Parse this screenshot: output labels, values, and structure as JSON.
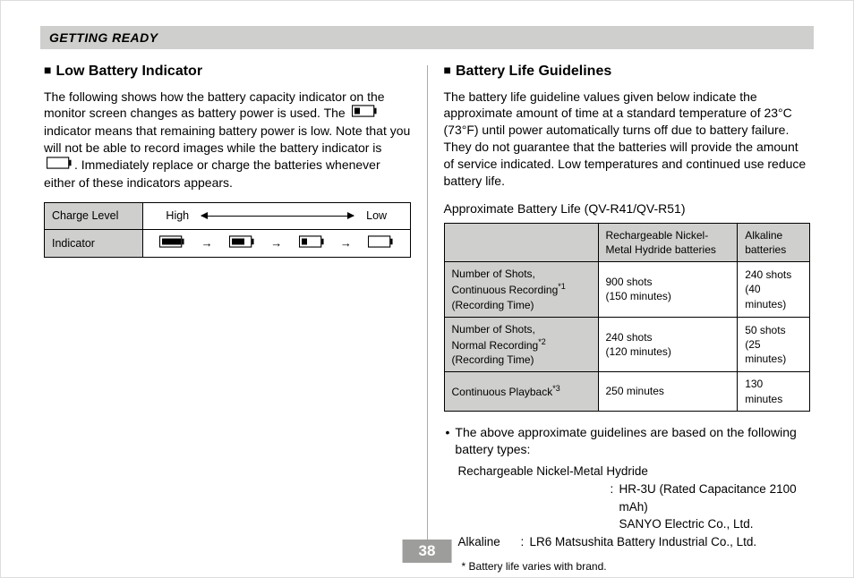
{
  "header": {
    "section": "GETTING READY"
  },
  "left": {
    "heading": "Low Battery Indicator",
    "para_a": "The following shows how the battery capacity indicator on the monitor screen changes as battery power is used. The",
    "para_b": "indicator means that remaining battery power is low. Note that you will not be able to record images while the battery indicator is",
    "para_c": ". Immediately replace or charge the batteries whenever either of these indicators appears.",
    "table": {
      "row1label": "Charge Level",
      "high": "High",
      "low": "Low",
      "row2label": "Indicator"
    }
  },
  "right": {
    "heading": "Battery Life Guidelines",
    "para": "The battery life guideline values given below indicate the approximate amount of time at a standard temperature of 23°C (73°F) until power automatically turns off due to battery failure. They do not guarantee that the batteries will provide the amount of service indicated. Low temperatures and continued use reduce battery life.",
    "caption": "Approximate Battery Life (QV-R41/QV-R51)",
    "table": {
      "head_nmh": "Rechargeable Nickel-Metal Hydride batteries",
      "head_alk": "Alkaline batteries",
      "rows": [
        {
          "label_a": "Number of Shots,",
          "label_b": "Continuous Recording",
          "sup": "*1",
          "label_c": "(Recording Time)",
          "nmh_a": "900 shots",
          "nmh_b": "(150 minutes)",
          "alk_a": "240  shots",
          "alk_b": "(40 minutes)"
        },
        {
          "label_a": "Number of Shots,",
          "label_b": "Normal Recording",
          "sup": "*2",
          "label_c": "(Recording Time)",
          "nmh_a": "240 shots",
          "nmh_b": "(120 minutes)",
          "alk_a": "50 shots",
          "alk_b": "(25 minutes)"
        },
        {
          "label_a": "Continuous Playback",
          "label_b": "",
          "sup": "*3",
          "label_c": "",
          "nmh_a": "250 minutes",
          "nmh_b": "",
          "alk_a": "130 minutes",
          "alk_b": ""
        }
      ]
    },
    "bullet": "The above approximate guidelines are based on the following battery types:",
    "spec": {
      "nmh_label": "Rechargeable Nickel-Metal Hydride",
      "nmh_val1": "HR-3U (Rated Capacitance 2100 mAh)",
      "nmh_val2": "SANYO Electric Co., Ltd.",
      "alk_label": "Alkaline",
      "alk_val": "LR6 Matsushita Battery Industrial Co., Ltd."
    },
    "footnote": "Battery life varies with brand."
  },
  "pageNumber": "38"
}
